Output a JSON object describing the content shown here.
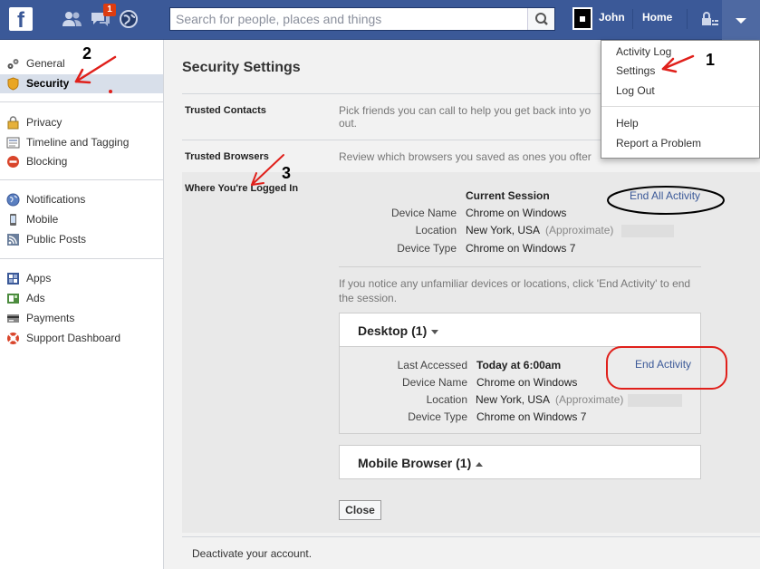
{
  "topbar": {
    "logo": "f",
    "notification_count": "1",
    "search_placeholder": "Search for people, places and things",
    "user_name": "John",
    "home_label": "Home"
  },
  "sidebar": {
    "groups": [
      [
        {
          "label": "General",
          "icon": "gears-icon"
        },
        {
          "label": "Security",
          "icon": "shield-icon",
          "selected": true
        }
      ],
      [
        {
          "label": "Privacy",
          "icon": "lock-icon"
        },
        {
          "label": "Timeline and Tagging",
          "icon": "timeline-icon"
        },
        {
          "label": "Blocking",
          "icon": "blocking-icon"
        }
      ],
      [
        {
          "label": "Notifications",
          "icon": "globe-icon"
        },
        {
          "label": "Mobile",
          "icon": "mobile-icon"
        },
        {
          "label": "Public Posts",
          "icon": "rss-icon"
        }
      ],
      [
        {
          "label": "Apps",
          "icon": "apps-icon"
        },
        {
          "label": "Ads",
          "icon": "ads-icon"
        },
        {
          "label": "Payments",
          "icon": "card-icon"
        },
        {
          "label": "Support Dashboard",
          "icon": "lifebuoy-icon"
        }
      ]
    ]
  },
  "main": {
    "title": "Security Settings",
    "trusted_contacts": {
      "label": "Trusted Contacts",
      "desc_line1": "Pick friends you can call to help you get back into yo",
      "desc_line2": "out."
    },
    "trusted_browsers": {
      "label": "Trusted Browsers",
      "desc": "Review which browsers you saved as ones you ofter"
    },
    "logged_in": {
      "label": "Where You're Logged In",
      "current_session_title": "Current Session",
      "end_all_label": "End All Activity",
      "current": {
        "device_name_label": "Device Name",
        "device_name": "Chrome on Windows",
        "location_label": "Location",
        "location": "New York, USA",
        "approx": "(Approximate)",
        "device_type_label": "Device Type",
        "device_type": "Chrome on Windows 7"
      },
      "notice_line1": "If you notice any unfamiliar devices or locations, click 'End Activity' to end",
      "notice_line2": "the session.",
      "desktop": {
        "title": "Desktop (1)",
        "last_accessed_label": "Last Accessed",
        "last_accessed": "Today at 6:00am",
        "end_activity_label": "End Activity",
        "device_name_label": "Device Name",
        "device_name": "Chrome on Windows",
        "location_label": "Location",
        "location": "New York, USA",
        "approx": "(Approximate)",
        "device_type_label": "Device Type",
        "device_type": "Chrome on Windows 7"
      },
      "mobile": {
        "title": "Mobile Browser (1)"
      },
      "close_label": "Close"
    },
    "deactivate": "Deactivate your account."
  },
  "dropdown": {
    "items_top": [
      "Activity Log",
      "Settings",
      "Log Out"
    ],
    "items_bottom": [
      "Help",
      "Report a Problem"
    ]
  },
  "annotations": {
    "step1": "1",
    "step2": "2",
    "step3": "3",
    "color": "#e0201b"
  }
}
